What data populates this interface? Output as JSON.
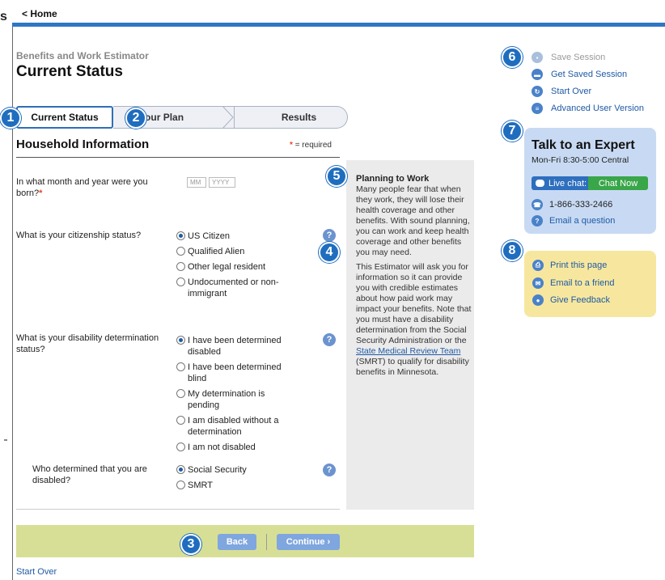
{
  "clipped_left_glyph": "s",
  "topbar": {
    "home_label": "< Home"
  },
  "header": {
    "app_label": "Benefits and Work Estimator",
    "title": "Current Status"
  },
  "steps": [
    {
      "label": "Current Status",
      "badge": "1",
      "state": "active"
    },
    {
      "label": "Your Plan",
      "badge": "2",
      "state": "inactive"
    },
    {
      "label": "Results",
      "badge": "",
      "state": "inactive"
    }
  ],
  "section": {
    "title": "Household Information",
    "required_star": "*",
    "required_note": "= required"
  },
  "questions": {
    "birth": {
      "label": "In what month and year were you born?",
      "required": "*",
      "month_placeholder": "MM",
      "year_placeholder": "YYYY"
    },
    "citizenship": {
      "label": "What is your citizenship status?",
      "options": [
        "US Citizen",
        "Qualified Alien",
        "Other legal resident",
        "Undocumented or non-immigrant"
      ],
      "selected": "US Citizen",
      "help": "?"
    },
    "disability": {
      "label": "What is your disability determination status?",
      "options": [
        "I have been determined disabled",
        "I have been determined blind",
        "My determination is pending",
        "I am disabled without a determination",
        "I am not disabled"
      ],
      "selected": "I have been determined disabled",
      "help": "?"
    },
    "determiner": {
      "label": "Who determined that you are disabled?",
      "options": [
        "Social Security",
        "SMRT"
      ],
      "selected": "Social Security",
      "help": "?"
    }
  },
  "info_panel": {
    "title": "Planning to Work",
    "paragraph1": "Many people fear that when they work, they will lose their health coverage and other benefits. With sound planning, you can work and keep health coverage and other benefits you may need.",
    "paragraph2_before": "This Estimator will ask you for information so it can provide you with credible estimates about how paid work may impact your benefits. Note that you must have a disability determination from the Social Security Administration or the ",
    "paragraph2_link": "State Medical Review Team",
    "paragraph2_after": " (SMRT) to qualify for disability benefits in Minnesota."
  },
  "actions": {
    "back_label": "Back",
    "continue_label": "Continue ›",
    "start_over_label": "Start Over"
  },
  "sidebar": {
    "save_session": "Save Session",
    "get_saved_session": "Get Saved Session",
    "start_over": "Start Over",
    "advanced_user_version": "Advanced User Version"
  },
  "expert": {
    "title": "Talk to an Expert",
    "hours": "Mon-Fri 8:30-5:00 Central",
    "live_chat_label": "Live chat:",
    "chat_now_label": "Chat Now",
    "phone": "1-866-333-2466",
    "email_question": "Email a question"
  },
  "share": {
    "print": "Print this page",
    "email_friend": "Email to a friend",
    "feedback": "Give Feedback"
  },
  "callouts": [
    "1",
    "2",
    "3",
    "4",
    "5",
    "6",
    "7",
    "8"
  ],
  "colors": {
    "accent_blue": "#2f76c4",
    "link_blue": "#1f5aa6",
    "action_bar": "#d7df96",
    "expert_box": "#c8daf3",
    "share_box": "#f7e79e",
    "chat_now": "#39a64a",
    "required_star": "#e8491d"
  }
}
